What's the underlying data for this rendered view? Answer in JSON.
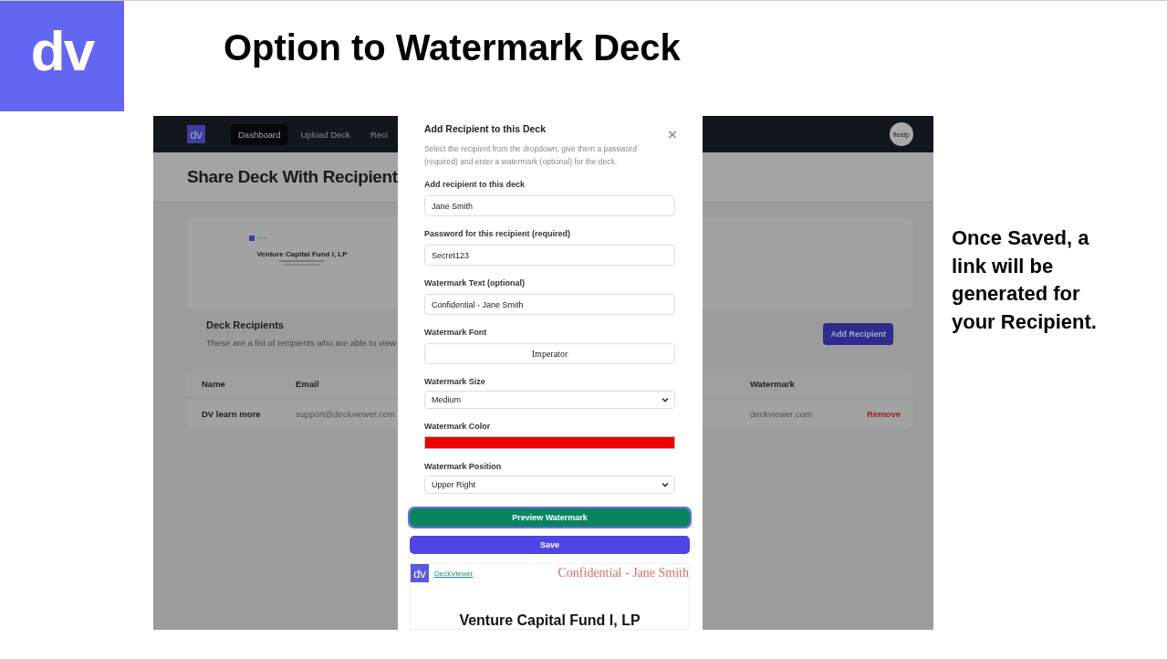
{
  "slide": {
    "logo": "dv",
    "title": "Option to Watermark Deck",
    "note": "Once Saved, a link will be generated for your Recipient."
  },
  "app": {
    "logo": "dv",
    "nav": [
      {
        "label": "Dashboard",
        "selected": true
      },
      {
        "label": "Upload Deck",
        "selected": false
      },
      {
        "label": "Reci",
        "selected": false
      }
    ],
    "avatar": "fieldp",
    "page_title": "Share Deck With Recipient",
    "deck_thumbnail": {
      "title": "Venture Capital Fund I, LP"
    },
    "recipients": {
      "title": "Deck Recipients",
      "description": "These are a list of recipients who are able to view",
      "add_button": "Add Recipient"
    },
    "table": {
      "columns": [
        "Name",
        "Email",
        "Watermark"
      ],
      "rows": [
        {
          "name": "DV learn more",
          "email": "support@deckviewer.com",
          "watermark": "deckviewer.com",
          "action": "Remove"
        }
      ]
    }
  },
  "modal": {
    "title": "Add Recipient to this Deck",
    "close": "×",
    "description": "Select the recipient from the dropdown, give them a password (required) and enter a watermark (optional) for the deck.",
    "fields": [
      {
        "label": "Add recipient to this deck",
        "kind": "text",
        "value": "Jane Smith"
      },
      {
        "label": "Password for this recipient (required)",
        "kind": "text",
        "value": "Secret123"
      },
      {
        "label": "Watermark Text (optional)",
        "kind": "text",
        "value": "Confidential - Jane Smith"
      },
      {
        "label": "Watermark Font",
        "kind": "font",
        "value": "Imperator"
      },
      {
        "label": "Watermark Size",
        "kind": "select",
        "value": "Medium"
      },
      {
        "label": "Watermark Color",
        "kind": "color",
        "color": "#ee0000"
      },
      {
        "label": "Watermark Position",
        "kind": "select",
        "value": "Upper Right"
      }
    ],
    "preview_button": "Preview Watermark",
    "save_button": "Save",
    "preview": {
      "logo": "dv",
      "brand": "DeckViewer",
      "watermark": "Confidential - Jane Smith",
      "title": "Venture Capital Fund I, LP"
    }
  }
}
